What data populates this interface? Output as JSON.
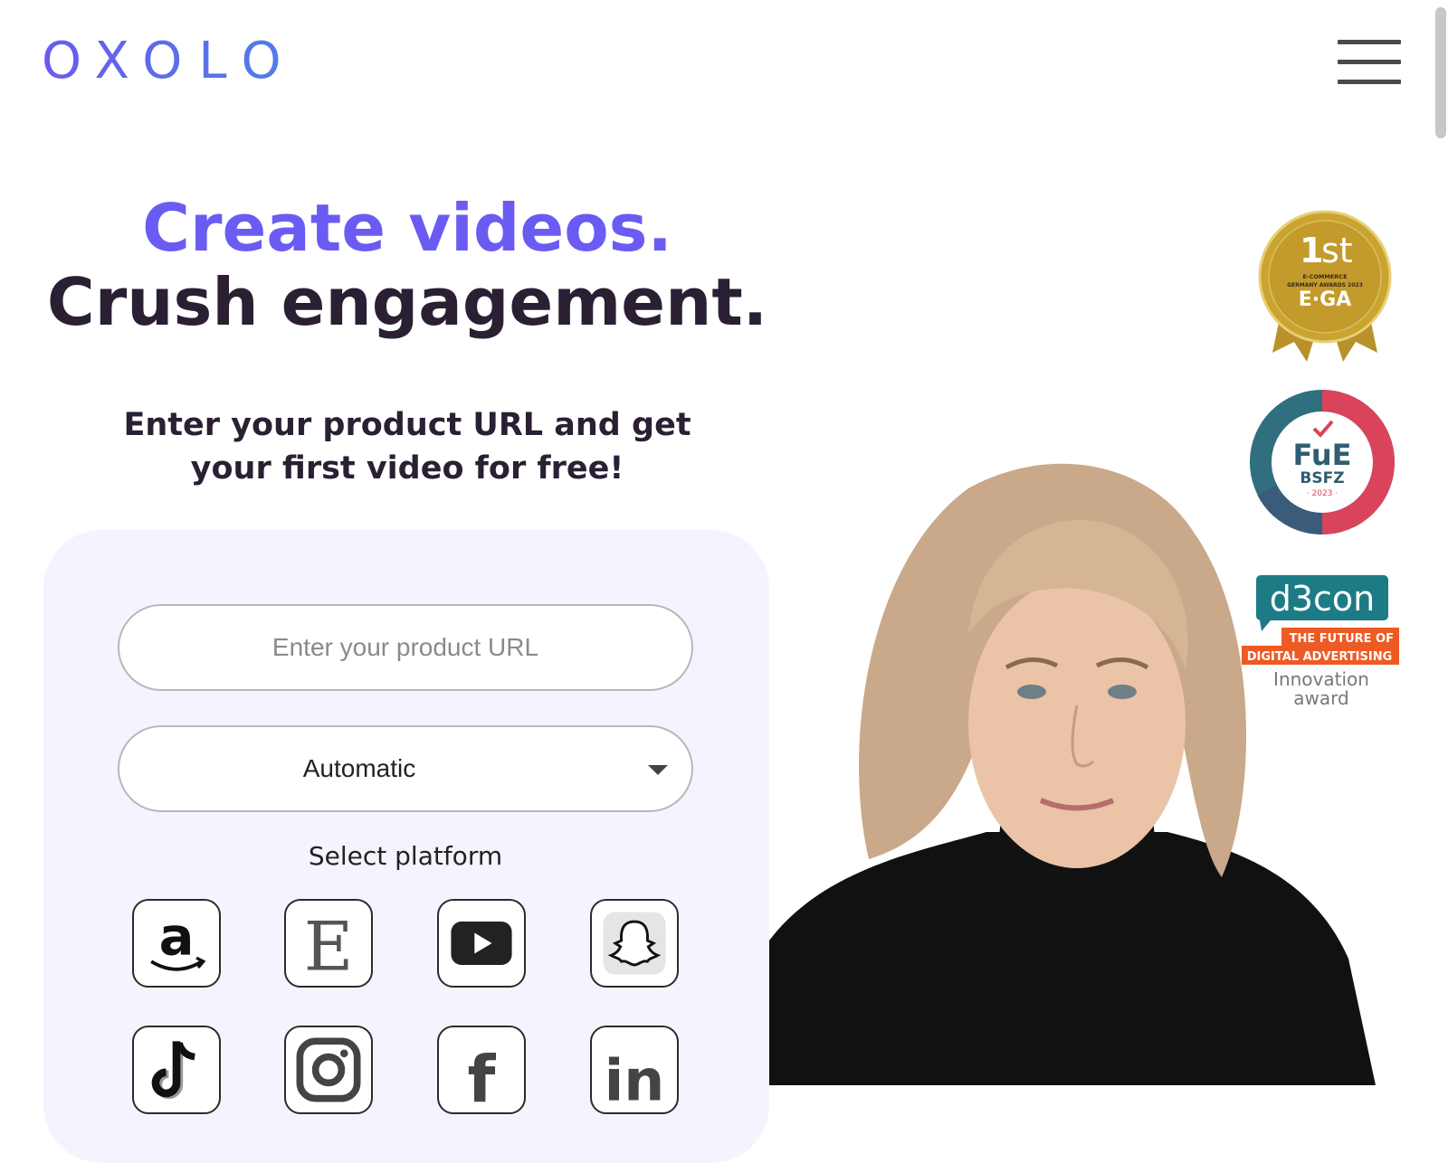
{
  "header": {
    "logo_text": "OXOLO",
    "menu_icon": "hamburger-menu-icon"
  },
  "hero": {
    "line1": "Create videos.",
    "line2": "Crush engagement.",
    "subtitle": "Enter your product URL and get your first video for free!"
  },
  "form": {
    "url_placeholder": "Enter your product URL",
    "url_value": "",
    "mode_selected": "Automatic",
    "platform_label": "Select platform",
    "platforms": [
      {
        "name": "Amazon",
        "icon": "amazon-icon"
      },
      {
        "name": "Etsy",
        "icon": "etsy-icon"
      },
      {
        "name": "YouTube",
        "icon": "youtube-icon"
      },
      {
        "name": "Snapchat",
        "icon": "snapchat-icon"
      },
      {
        "name": "TikTok",
        "icon": "tiktok-icon"
      },
      {
        "name": "Instagram",
        "icon": "instagram-icon"
      },
      {
        "name": "Facebook",
        "icon": "facebook-icon"
      },
      {
        "name": "LinkedIn",
        "icon": "linkedin-icon"
      }
    ]
  },
  "awards": {
    "ega": {
      "rank_num": "1",
      "rank_suffix": "st",
      "line1": "E-COMMERCE",
      "line2": "GERMANY AWARDS 2023",
      "name": "E·GA"
    },
    "fue": {
      "title": "FuE",
      "org": "BSFZ",
      "year": "· 2023 ·"
    },
    "d3con": {
      "name": "d3con",
      "tag1": "THE FUTURE OF",
      "tag2": "DIGITAL ADVERTISING",
      "award1": "Innovation",
      "award2": "award"
    }
  },
  "colors": {
    "brand_purple": "#6a5cf2",
    "dark_text": "#2a1f33",
    "card_bg": "#f5f4fe",
    "ega_gold": "#c9a430",
    "fue_teal": "#2f7d86",
    "fue_red": "#d9445b",
    "d3con_teal": "#1d7b86",
    "d3con_orange": "#ee5a24"
  }
}
